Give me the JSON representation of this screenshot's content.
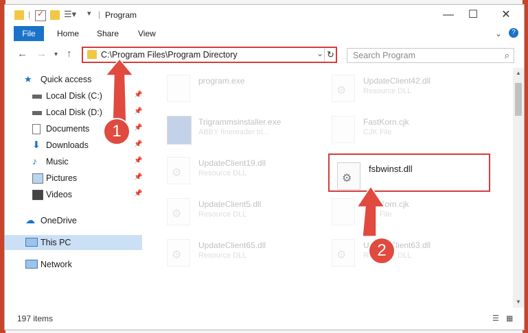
{
  "window": {
    "title": "Program",
    "controls": {
      "minimize": "—",
      "maximize": "☐",
      "close": "✕"
    }
  },
  "ribbon": {
    "tabs": [
      "File",
      "Home",
      "Share",
      "View"
    ],
    "expand_icon": "chevron-down-icon",
    "help_icon": "help-icon"
  },
  "address": {
    "path": "C:\\Program Files\\Program Directory",
    "search_placeholder": "Search Program"
  },
  "navpane": {
    "quick_access": "Quick access",
    "items": [
      {
        "label": "Local Disk (C:)",
        "icon": "drive-icon",
        "pinned": true
      },
      {
        "label": "Local Disk (D:)",
        "icon": "drive-icon",
        "pinned": true
      },
      {
        "label": "Documents",
        "icon": "documents-icon",
        "pinned": true
      },
      {
        "label": "Downloads",
        "icon": "download-icon",
        "pinned": true
      },
      {
        "label": "Music",
        "icon": "music-icon",
        "pinned": true
      },
      {
        "label": "Pictures",
        "icon": "pictures-icon",
        "pinned": true
      },
      {
        "label": "Videos",
        "icon": "videos-icon",
        "pinned": true
      }
    ],
    "onedrive": "OneDrive",
    "this_pc": "This PC",
    "network": "Network"
  },
  "files": [
    {
      "name": "program.exe",
      "type": ""
    },
    {
      "name": "UpdateClient42.dll",
      "type": "Resource DLL"
    },
    {
      "name": "Trigrammsinstaller.exe",
      "type": "ABBY finereader tri..."
    },
    {
      "name": "FastKorn.cjk",
      "type": "CJK File"
    },
    {
      "name": "UpdateClient19.dll",
      "type": "Resource DLL"
    },
    {
      "name": "fsbwinst.dll",
      "type": ""
    },
    {
      "name": "UpdateClient5.dll",
      "type": "Resource DLL"
    },
    {
      "name": "FastKorn.cjk",
      "type": "CJK File"
    },
    {
      "name": "UpdateClient65.dll",
      "type": "Resource DLL"
    },
    {
      "name": "UpdateClient63.dll",
      "type": "Resource DLL"
    }
  ],
  "status": {
    "item_count": "197 items"
  },
  "annotations": {
    "step1": "1",
    "step2": "2",
    "accent": "#e04a3f"
  }
}
